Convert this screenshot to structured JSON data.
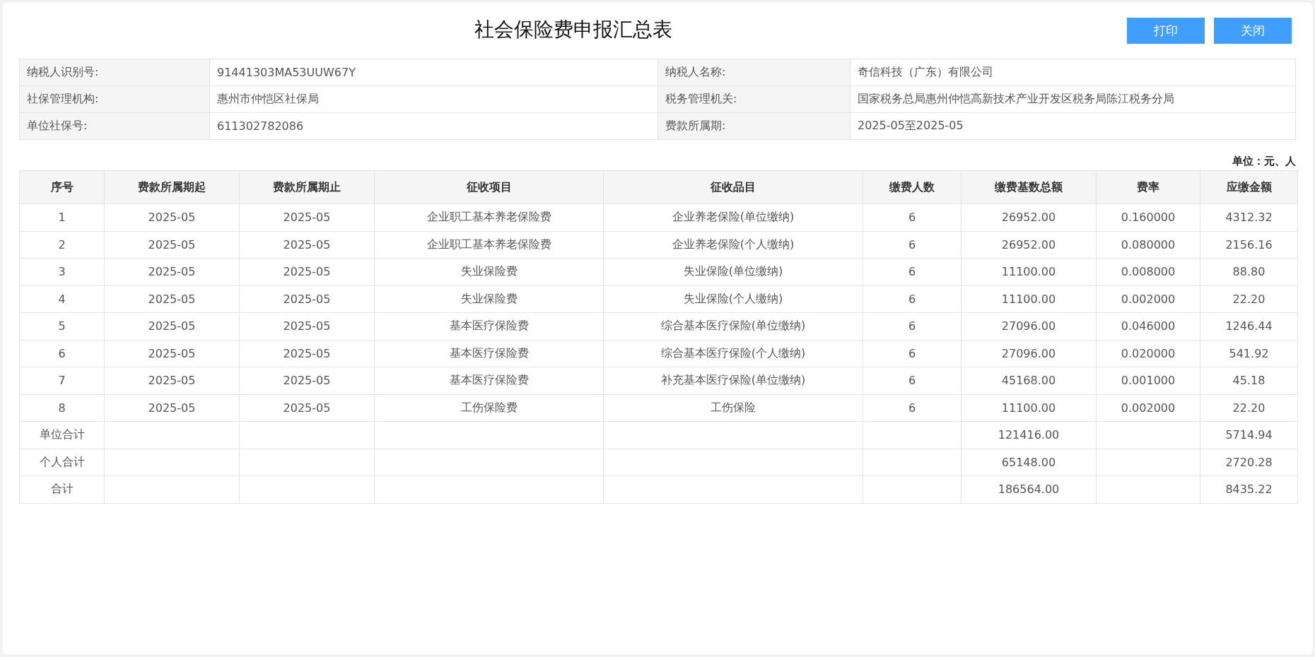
{
  "title": "社会保险费申报汇总表",
  "buttons": [
    "打印",
    "关闭"
  ],
  "info": [
    {
      "label": "纳税人识别号:",
      "value": "91441303MA53UUW67Y",
      "label2": "纳税人名称:",
      "value2": "奇信科技（广东）有限公司"
    },
    {
      "label": "社保管理机构:",
      "value": "惠州市仲恺区社保局",
      "label2": "税务管理机关:",
      "value2": "国家税务总局惠州仲恺高新技术产业开发区税务局陈江税务分局"
    },
    {
      "label": "单位社保号:",
      "value": "611302782086",
      "label2": "费款所属期:",
      "value2": "2025-05至2025-05"
    }
  ],
  "unit_note": "单位：元、人",
  "table": {
    "columns": [
      "序号",
      "费款所属期起",
      "费款所属期止",
      "征收项目",
      "征收品目",
      "缴费人数",
      "缴费基数总额",
      "费率",
      "应缴金额"
    ],
    "rows": [
      [
        "1",
        "2025-05",
        "2025-05",
        "企业职工基本养老保险费",
        "企业养老保险(单位缴纳)",
        "6",
        "26952.00",
        "0.160000",
        "4312.32"
      ],
      [
        "2",
        "2025-05",
        "2025-05",
        "企业职工基本养老保险费",
        "企业养老保险(个人缴纳)",
        "6",
        "26952.00",
        "0.080000",
        "2156.16"
      ],
      [
        "3",
        "2025-05",
        "2025-05",
        "失业保险费",
        "失业保险(单位缴纳)",
        "6",
        "11100.00",
        "0.008000",
        "88.80"
      ],
      [
        "4",
        "2025-05",
        "2025-05",
        "失业保险费",
        "失业保险(个人缴纳)",
        "6",
        "11100.00",
        "0.002000",
        "22.20"
      ],
      [
        "5",
        "2025-05",
        "2025-05",
        "基本医疗保险费",
        "综合基本医疗保险(单位缴纳)",
        "6",
        "27096.00",
        "0.046000",
        "1246.44"
      ],
      [
        "6",
        "2025-05",
        "2025-05",
        "基本医疗保险费",
        "综合基本医疗保险(个人缴纳)",
        "6",
        "27096.00",
        "0.020000",
        "541.92"
      ],
      [
        "7",
        "2025-05",
        "2025-05",
        "基本医疗保险费",
        "补充基本医疗保险(单位缴纳)",
        "6",
        "45168.00",
        "0.001000",
        "45.18"
      ],
      [
        "8",
        "2025-05",
        "2025-05",
        "工伤保险费",
        "工伤保险",
        "6",
        "11100.00",
        "0.002000",
        "22.20"
      ]
    ],
    "totals": [
      {
        "label": "单位合计",
        "base_total": "121416.00",
        "amount": "5714.94"
      },
      {
        "label": "个人合计",
        "base_total": "65148.00",
        "amount": "2720.28"
      },
      {
        "label": "合计",
        "base_total": "186564.00",
        "amount": "8435.22"
      }
    ]
  }
}
